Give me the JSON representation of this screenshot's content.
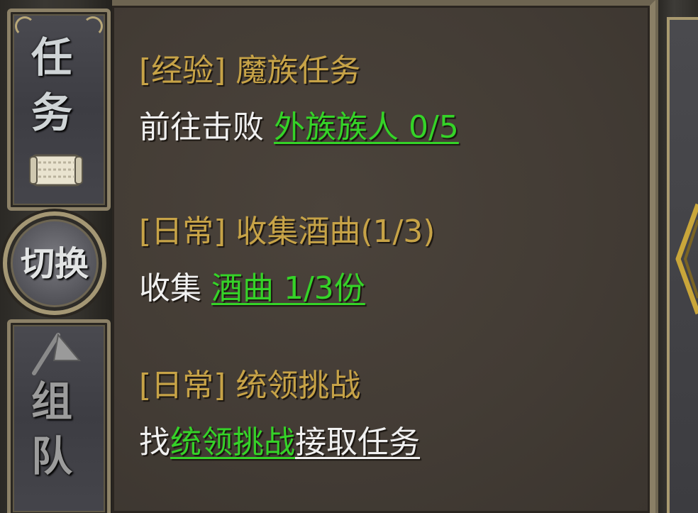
{
  "tabs": {
    "task_tab": {
      "chars": [
        "任",
        "务"
      ],
      "icon": "scroll-icon"
    },
    "switch_button": {
      "label": "切换"
    },
    "team_tab": {
      "chars": [
        "组",
        "队"
      ],
      "icon": "triangle-icon"
    }
  },
  "quests": [
    {
      "title": "[经验] 魔族任务",
      "desc_prefix": "前往击败 ",
      "target": "外族族人 0/5",
      "desc_suffix": ""
    },
    {
      "title": "[日常] 收集酒曲(1/3)",
      "desc_prefix": "收集 ",
      "target": "酒曲 1/3份",
      "desc_suffix": ""
    },
    {
      "title": "[日常] 统领挑战",
      "desc_prefix": "找",
      "target": "统领挑战",
      "desc_suffix": "接取任务"
    }
  ],
  "colors": {
    "title_gold": "#c7a347",
    "target_green": "#35d328",
    "desc_white": "#f0f0f0",
    "frame_gold": "#a99a70"
  },
  "right_panel": {
    "icon": "chevron-left-icon"
  }
}
